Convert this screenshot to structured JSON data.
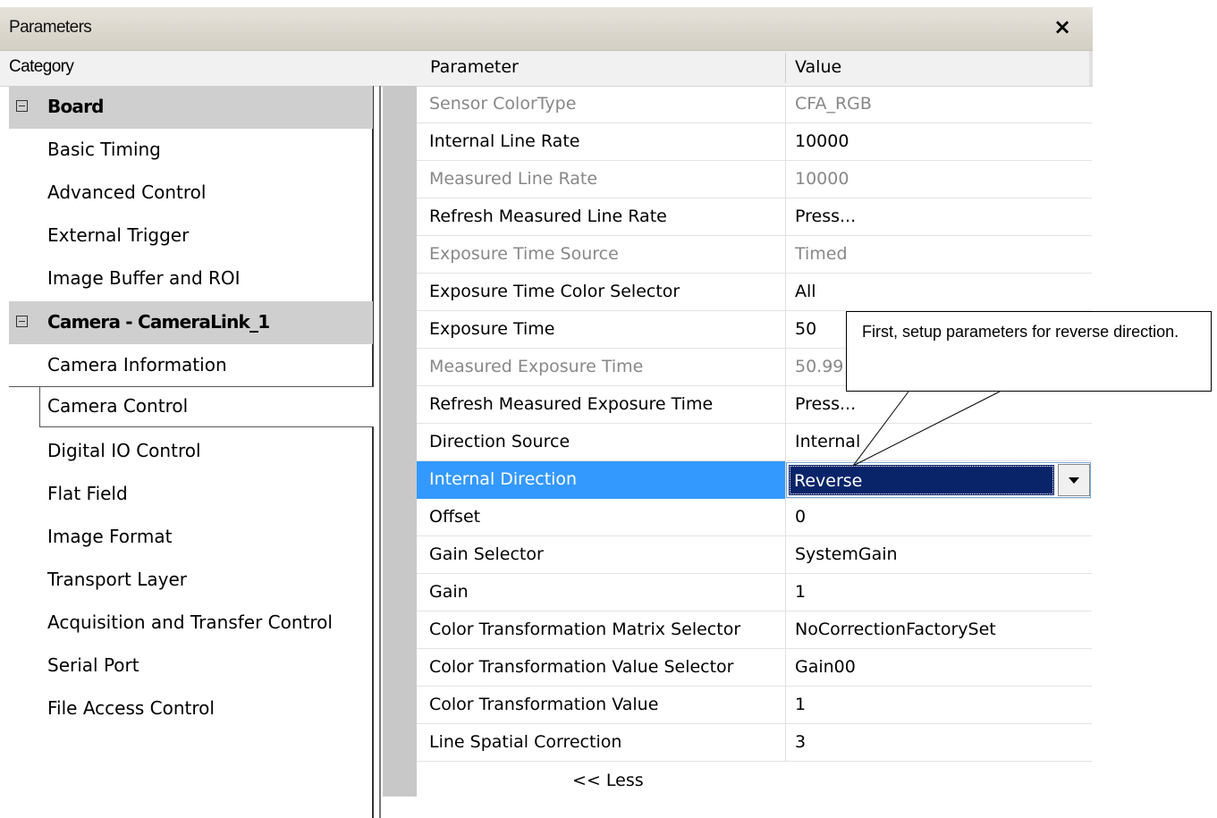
{
  "window": {
    "title": "Parameters",
    "close_label": "×"
  },
  "headers": {
    "category": "Category",
    "parameter": "Parameter",
    "value": "Value"
  },
  "categories": {
    "board": {
      "label": "Board",
      "items": [
        "Basic Timing",
        "Advanced Control",
        "External Trigger",
        "Image Buffer and ROI"
      ]
    },
    "camera": {
      "label": "Camera - CameraLink_1",
      "items": [
        "Camera Information",
        "Camera Control",
        "Digital IO Control",
        "Flat Field",
        "Image Format",
        "Transport Layer",
        "Acquisition and Transfer Control",
        "Serial Port",
        "File Access Control"
      ],
      "selected": "Camera Control"
    }
  },
  "parameters": [
    {
      "name": "Sensor ColorType",
      "value": "CFA_RGB",
      "readonly": true
    },
    {
      "name": "Internal Line Rate",
      "value": "10000",
      "readonly": false
    },
    {
      "name": "Measured Line Rate",
      "value": "10000",
      "readonly": true
    },
    {
      "name": "Refresh Measured Line Rate",
      "value": "Press...",
      "readonly": false
    },
    {
      "name": "Exposure Time Source",
      "value": "Timed",
      "readonly": true
    },
    {
      "name": "Exposure Time Color Selector",
      "value": "All",
      "readonly": false
    },
    {
      "name": "Exposure Time",
      "value": "50",
      "readonly": false
    },
    {
      "name": "Measured Exposure Time",
      "value": "50.99",
      "readonly": true
    },
    {
      "name": "Refresh Measured Exposure Time",
      "value": "Press...",
      "readonly": false
    },
    {
      "name": "Direction Source",
      "value": "Internal",
      "readonly": false
    },
    {
      "name": "Internal Direction",
      "value": "Reverse",
      "readonly": false,
      "selected": true
    },
    {
      "name": "Offset",
      "value": "0",
      "readonly": false
    },
    {
      "name": "Gain Selector",
      "value": "SystemGain",
      "readonly": false
    },
    {
      "name": "Gain",
      "value": "1",
      "readonly": false
    },
    {
      "name": "Color Transformation Matrix Selector",
      "value": "NoCorrectionFactorySet",
      "readonly": false
    },
    {
      "name": "Color Transformation Value Selector",
      "value": "Gain00",
      "readonly": false
    },
    {
      "name": "Color Transformation Value",
      "value": "1",
      "readonly": false
    },
    {
      "name": "Line Spatial Correction",
      "value": "3",
      "readonly": false
    }
  ],
  "less_label": "<< Less",
  "callout": {
    "text": "First, setup parameters for reverse direction."
  },
  "icons": {
    "close": "close-icon",
    "collapse": "collapse-icon",
    "dropdown": "chevron-down-icon"
  },
  "colors": {
    "selection": "#3399ff",
    "dropdown_highlight": "#0a246a",
    "group_header": "#cfcfcf",
    "readonly_text": "#888888"
  }
}
